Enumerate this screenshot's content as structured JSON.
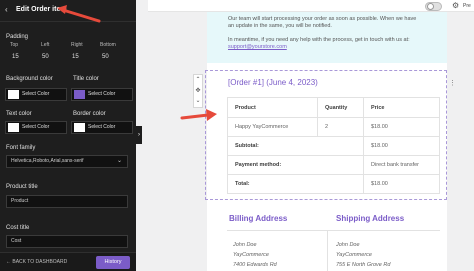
{
  "sidebar": {
    "back_glyph": "‹",
    "title": "Edit Order item",
    "padding": {
      "label": "Padding",
      "fields": [
        {
          "label": "Top",
          "value": "15"
        },
        {
          "label": "Left",
          "value": "50"
        },
        {
          "label": "Right",
          "value": "15"
        },
        {
          "label": "Bottom",
          "value": "50"
        }
      ]
    },
    "background_color": {
      "label": "Background color",
      "button": "Select Color",
      "swatch": "#ffffff"
    },
    "title_color": {
      "label": "Title color",
      "button": "Select Color",
      "swatch": "#7b5cc8"
    },
    "text_color": {
      "label": "Text color",
      "button": "Select Color",
      "swatch": "#ffffff"
    },
    "border_color": {
      "label": "Border color",
      "button": "Select Color",
      "swatch": "#ffffff"
    },
    "font_family": {
      "label": "Font family",
      "value": "Helvetica,Roboto,Arial,sans-serif",
      "chevron": "⌄"
    },
    "product_title": {
      "label": "Product title",
      "value": "Product"
    },
    "cost_title": {
      "label": "Cost title",
      "value": "Cost"
    },
    "footer": {
      "back_label": "← BACK TO DASHBOARD",
      "history_button": "History"
    },
    "collapse_glyph": "›"
  },
  "topbar": {
    "settings_glyph": "⚙",
    "preview_label": "Pre"
  },
  "email": {
    "notice_lines": [
      "Our team will start processing your order as soon as possible. When we have",
      "an update in the same, you will be notified.",
      "In meantime, if you need any help with the process, get in touch with us at:"
    ],
    "support_email": "support@yourstore.com",
    "order_title": "[Order #1] (June 4, 2023)",
    "table": {
      "headers": [
        "Product",
        "Quantity",
        "Price"
      ],
      "item": {
        "product": "Happy YayCommerce",
        "quantity": "2",
        "price": "$18.00"
      },
      "summary": [
        {
          "label": "Subtotal:",
          "value": "$18.00"
        },
        {
          "label": "Payment method:",
          "value": "Direct bank transfer"
        },
        {
          "label": "Total:",
          "value": "$18.00"
        }
      ]
    },
    "billing": {
      "title": "Billing Address",
      "name": "John Doe",
      "company": "YayCommerce",
      "street": "7400 Edwards Rd"
    },
    "shipping": {
      "title": "Shipping Address",
      "name": "John Doe",
      "company": "YayCommerce",
      "street": "755 E North Grove Rd"
    }
  },
  "toolbar_glyphs": {
    "up": "⌃",
    "move": "✥",
    "down": "⌄",
    "more": "⋮"
  },
  "colors": {
    "accent": "#7b5cc8",
    "sidebar_bg": "#1e1e1e",
    "notice_bg": "#e6f8fa",
    "annotation_arrow": "#e64a3b"
  }
}
